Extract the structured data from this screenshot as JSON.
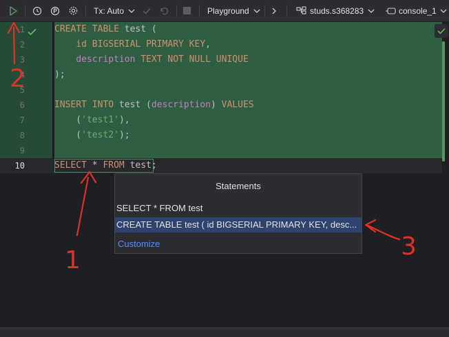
{
  "toolbar": {
    "tx_label": "Tx: Auto",
    "playground_label": "Playground",
    "datasource_label": "studs.s368283",
    "console_label": "console_1"
  },
  "editor": {
    "line_numbers": [
      "1",
      "2",
      "3",
      "4",
      "5",
      "6",
      "7",
      "8",
      "9",
      "10"
    ],
    "lines": [
      [
        {
          "t": "CREATE TABLE ",
          "c": "kw"
        },
        {
          "t": "test (",
          "c": "plain"
        }
      ],
      [
        {
          "t": "    ",
          "c": "plain"
        },
        {
          "t": "id ",
          "c": "kw"
        },
        {
          "t": "BIGSERIAL PRIMARY KEY",
          "c": "kw"
        },
        {
          "t": ",",
          "c": "plain"
        }
      ],
      [
        {
          "t": "    ",
          "c": "plain"
        },
        {
          "t": "description ",
          "c": "fn"
        },
        {
          "t": "TEXT NOT NULL UNIQUE",
          "c": "kw"
        }
      ],
      [
        {
          "t": ");",
          "c": "plain"
        }
      ],
      [],
      [
        {
          "t": "INSERT INTO ",
          "c": "kw"
        },
        {
          "t": "test (",
          "c": "plain"
        },
        {
          "t": "description",
          "c": "fn"
        },
        {
          "t": ") ",
          "c": "plain"
        },
        {
          "t": "VALUES",
          "c": "kw"
        }
      ],
      [
        {
          "t": "    (",
          "c": "plain"
        },
        {
          "t": "'test1'",
          "c": "str"
        },
        {
          "t": "),",
          "c": "plain"
        }
      ],
      [
        {
          "t": "    (",
          "c": "plain"
        },
        {
          "t": "'test2'",
          "c": "str"
        },
        {
          "t": ");",
          "c": "plain"
        }
      ],
      [],
      [
        {
          "t": "SELECT ",
          "c": "kw"
        },
        {
          "t": "* ",
          "c": "plain"
        },
        {
          "t": "FROM ",
          "c": "kw"
        },
        {
          "t": "test;",
          "c": "plain"
        }
      ]
    ]
  },
  "popup": {
    "title": "Statements",
    "items": [
      "SELECT * FROM test",
      "CREATE TABLE test ( id BIGSERIAL PRIMARY KEY, desc..."
    ],
    "customize": "Customize"
  },
  "annotations": [
    "1",
    "2",
    "3"
  ],
  "colors": {
    "selection": "#2e5f43",
    "run_icon": "#57965c",
    "annotation": "#e0302a",
    "popup_selected": "#2e436e",
    "link": "#548af7"
  }
}
